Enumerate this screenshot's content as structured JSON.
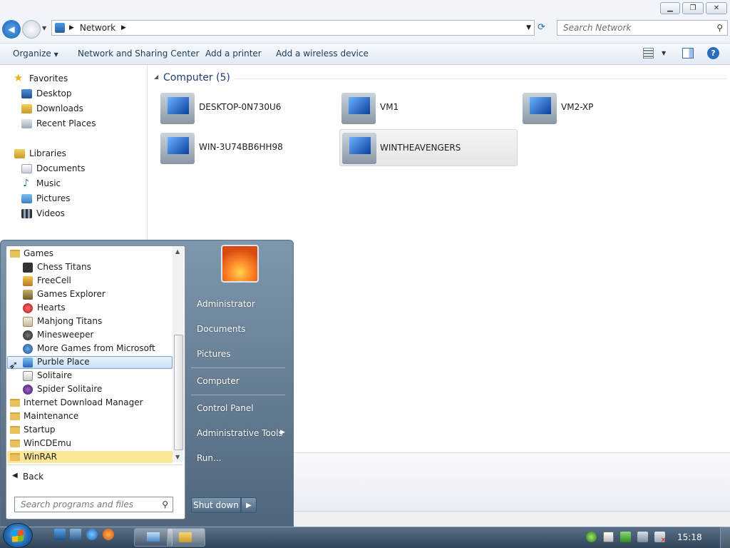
{
  "window": {
    "breadcrumb": "Network",
    "search_placeholder": "Search Network",
    "toolbar": {
      "organize": "Organize",
      "network_center": "Network and Sharing Center",
      "add_printer": "Add a printer",
      "add_wireless": "Add a wireless device"
    },
    "nav": {
      "favorites": "Favorites",
      "desktop": "Desktop",
      "downloads": "Downloads",
      "recent": "Recent Places",
      "libraries": "Libraries",
      "documents": "Documents",
      "music": "Music",
      "pictures": "Pictures",
      "videos": "Videos"
    },
    "group_header": "Computer (5)",
    "computers": [
      "DESKTOP-0N730U6",
      "VM1",
      "VM2-XP",
      "WIN-3U74BB6HH98",
      "WINTHEAVENGERS"
    ]
  },
  "startmenu": {
    "programs": {
      "games_folder": "Games",
      "games": [
        "Chess Titans",
        "FreeCell",
        "Games Explorer",
        "Hearts",
        "Mahjong Titans",
        "Minesweeper",
        "More Games from Microsoft",
        "Purble Place",
        "Solitaire",
        "Spider Solitaire"
      ],
      "folders": [
        "Internet Download Manager",
        "Maintenance",
        "Startup",
        "WinCDEmu",
        "WinRAR"
      ]
    },
    "back": "Back",
    "search_placeholder": "Search programs and files",
    "right": {
      "user": "Administrator",
      "documents": "Documents",
      "pictures": "Pictures",
      "computer": "Computer",
      "control_panel": "Control Panel",
      "admin_tools": "Administrative Tools",
      "run": "Run..."
    },
    "shutdown": "Shut down"
  },
  "taskbar": {
    "clock": "15:18"
  }
}
